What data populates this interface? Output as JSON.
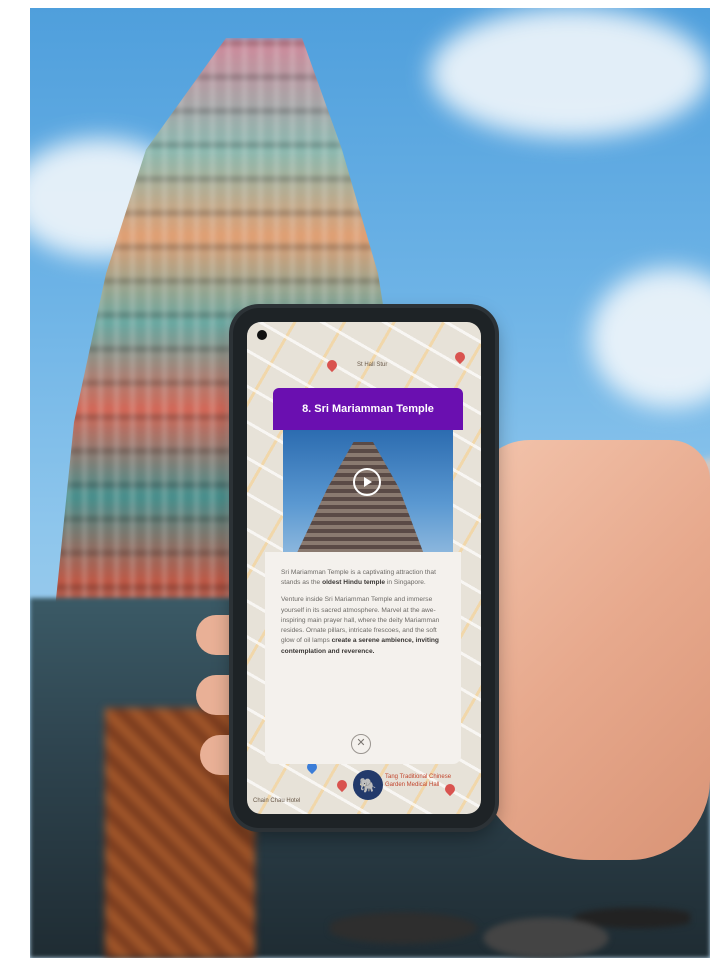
{
  "card": {
    "title": "8. Sri Mariamman Temple",
    "paragraph1_a": "Sri Mariamman Temple is a captivating attraction that stands as the ",
    "paragraph1_bold": "oldest Hindu temple",
    "paragraph1_b": " in Singapore.",
    "paragraph2_a": "Venture inside Sri Mariamman Temple and immerse yourself in its sacred atmosphere. Marvel at the awe-inspiring main prayer hall, where the deity Mariamman resides. Ornate pillars, intricate frescoes, and the soft glow of oil lamps ",
    "paragraph2_bold": "create a serene ambience, inviting contemplation and reverence.",
    "close_symbol": "✕",
    "play_icon": "play-icon"
  },
  "map": {
    "label_top": "St Hall Stur",
    "label_bottom_left": "Chain Chau Hotel",
    "poi_label": "Tang Traditional Chinese Garden Medical Hall",
    "poi_icon": "elephant-icon"
  },
  "colors": {
    "card_header": "#6a0fb0",
    "card_body": "#f4f1ed",
    "sky": "#6db3e6"
  }
}
